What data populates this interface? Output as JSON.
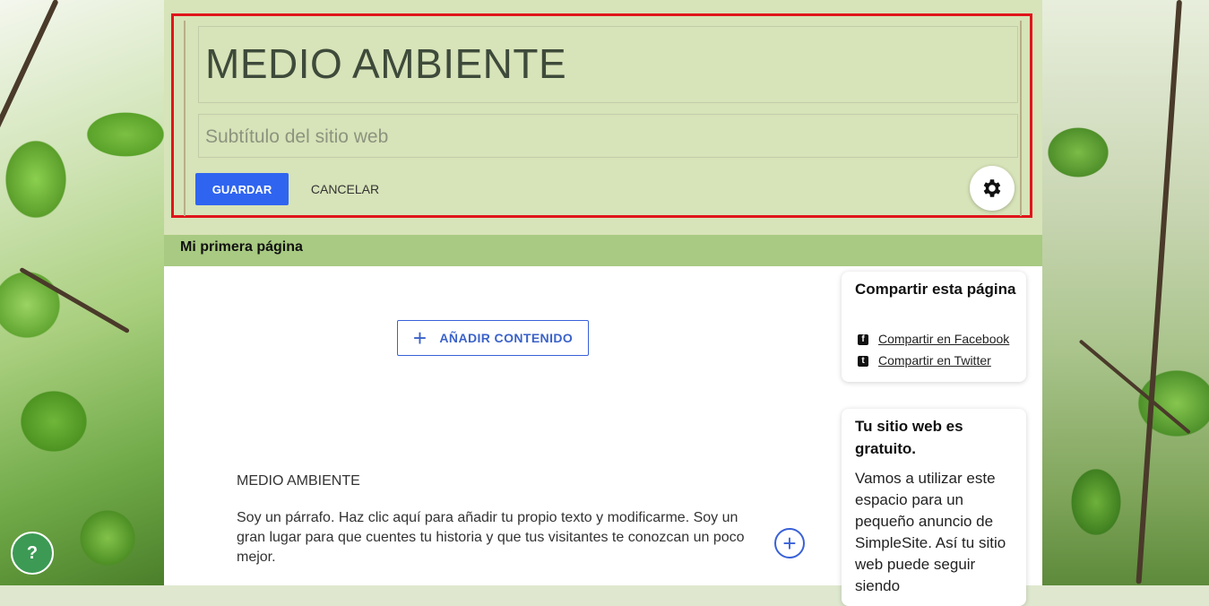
{
  "header": {
    "site_title": "MEDIO AMBIENTE",
    "subtitle_placeholder": "Subtítulo del sitio web",
    "save_label": "GUARDAR",
    "cancel_label": "CANCELAR",
    "settings_icon": "gear-icon"
  },
  "nav": {
    "items": [
      {
        "label": "Mi primera página"
      }
    ]
  },
  "content": {
    "add_content_label": "AÑADIR CONTENIDO",
    "section_title": "MEDIO AMBIENTE",
    "paragraph": "Soy un párrafo. Haz clic aquí para añadir tu propio texto y modificarme. Soy un gran lugar para que cuentes tu historia y que tus visitantes te conozcan un poco mejor."
  },
  "sidebar": {
    "share": {
      "title": "Compartir esta página",
      "links": [
        {
          "label": "Compartir en Facebook",
          "icon": "facebook-icon"
        },
        {
          "label": "Compartir en Twitter",
          "icon": "twitter-icon"
        }
      ]
    },
    "free": {
      "title": "Tu sitio web es gratuito.",
      "body": "Vamos a utilizar este espacio para un pequeño anuncio de SimpleSite. Así tu sitio web puede seguir siendo"
    }
  },
  "help": {
    "label": "?"
  },
  "colors": {
    "accent": "#2f64f0",
    "header_bg": "#d7e3b8",
    "nav_bg": "#a8ca82",
    "highlight_border": "#e0151b"
  }
}
